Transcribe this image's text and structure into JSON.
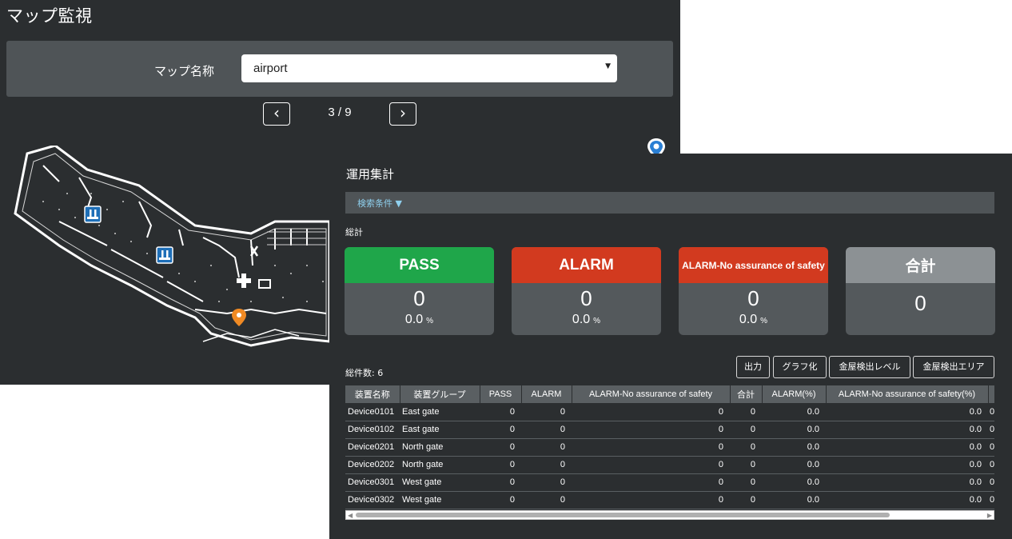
{
  "map_window": {
    "title": "マップ監視",
    "map_name_label": "マップ名称",
    "map_select_value": "airport",
    "pager": {
      "prev_icon": "chevron-left-icon",
      "next_icon": "chevron-right-icon",
      "text": "3 / 9"
    }
  },
  "summary": {
    "title": "運用集計",
    "search_toggle": "検索条件 ▼",
    "totals_heading": "総計",
    "cards": {
      "pass": {
        "label": "PASS",
        "count": "0",
        "percent": "0.0",
        "unit": "%",
        "color": "#1fa64a"
      },
      "alarm": {
        "label": "ALARM",
        "count": "0",
        "percent": "0.0",
        "unit": "%",
        "color": "#d23a1f"
      },
      "nosafety": {
        "label": "ALARM-No assurance of safety",
        "count": "0",
        "percent": "0.0",
        "unit": "%",
        "color": "#d23a1f"
      },
      "total": {
        "label": "合計",
        "count": "0",
        "color": "#8c9194"
      }
    },
    "record_count": "総件数: 6",
    "buttons": {
      "export": "出力",
      "graph": "グラフ化",
      "level": "金屋検出レベル",
      "area": "金屋検出エリア"
    },
    "table": {
      "headers": [
        "装置名称",
        "装置グループ",
        "PASS",
        "ALARM",
        "ALARM-No assurance of safety",
        "合計",
        "ALARM(%)",
        "ALARM-No assurance of safety(%)",
        ""
      ],
      "rows": [
        [
          "Device0101",
          "East gate",
          "0",
          "0",
          "0",
          "0",
          "0.0",
          "0.0",
          "0"
        ],
        [
          "Device0102",
          "East gate",
          "0",
          "0",
          "0",
          "0",
          "0.0",
          "0.0",
          "0"
        ],
        [
          "Device0201",
          "North gate",
          "0",
          "0",
          "0",
          "0",
          "0.0",
          "0.0",
          "0"
        ],
        [
          "Device0202",
          "North gate",
          "0",
          "0",
          "0",
          "0",
          "0.0",
          "0.0",
          "0"
        ],
        [
          "Device0301",
          "West gate",
          "0",
          "0",
          "0",
          "0",
          "0.0",
          "0.0",
          "0"
        ],
        [
          "Device0302",
          "West gate",
          "0",
          "0",
          "0",
          "0",
          "0.0",
          "0.0",
          "0"
        ]
      ]
    }
  }
}
